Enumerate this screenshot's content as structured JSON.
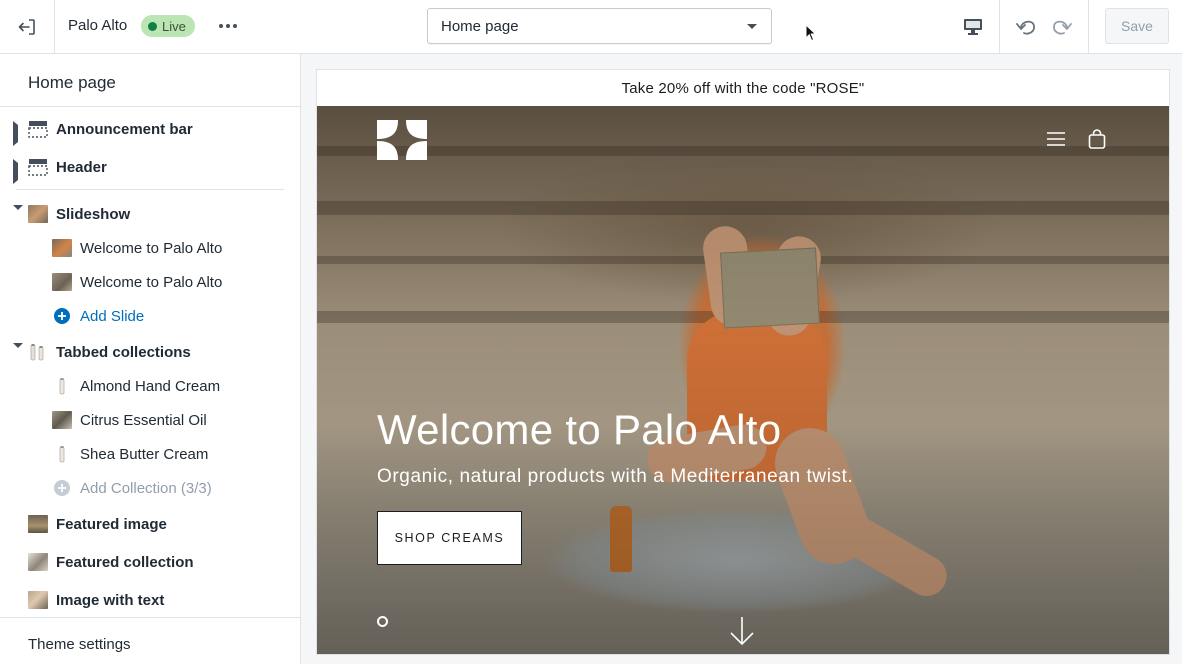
{
  "topbar": {
    "theme_name": "Palo Alto",
    "status_badge": "Live",
    "page_selector": {
      "selected": "Home page"
    },
    "save_label": "Save"
  },
  "sidebar": {
    "title": "Home page",
    "sections": [
      {
        "label": "Announcement bar",
        "expanded": false,
        "icon": "section-top-icon"
      },
      {
        "label": "Header",
        "expanded": false,
        "icon": "section-header-icon"
      },
      {
        "label": "Slideshow",
        "expanded": true,
        "icon": "slideshow-thumbnail",
        "children": [
          "Welcome to Palo Alto",
          "Welcome to Palo Alto"
        ],
        "add_label": "Add Slide"
      },
      {
        "label": "Tabbed collections",
        "expanded": true,
        "icon": "tabbed-collections-thumbnail",
        "children": [
          "Almond Hand Cream",
          "Citrus Essential Oil",
          "Shea Butter Cream"
        ],
        "add_label": "Add Collection (3/3)"
      },
      {
        "label": "Featured image",
        "icon": "featured-image-thumbnail"
      },
      {
        "label": "Featured collection",
        "icon": "featured-collection-thumbnail"
      },
      {
        "label": "Image with text",
        "icon": "image-with-text-thumbnail"
      }
    ],
    "footer_label": "Theme settings"
  },
  "preview": {
    "announcement": "Take 20% off with the code \"ROSE\"",
    "hero": {
      "title": "Welcome to Palo Alto",
      "subtitle": "Organic, natural products with a Mediterranean twist.",
      "cta_label": "SHOP CREAMS"
    }
  },
  "colors": {
    "live_badge_bg": "#bbe5b3",
    "live_dot": "#108043",
    "link_blue": "#006fbb",
    "swimsuit_orange": "#d8753a"
  }
}
